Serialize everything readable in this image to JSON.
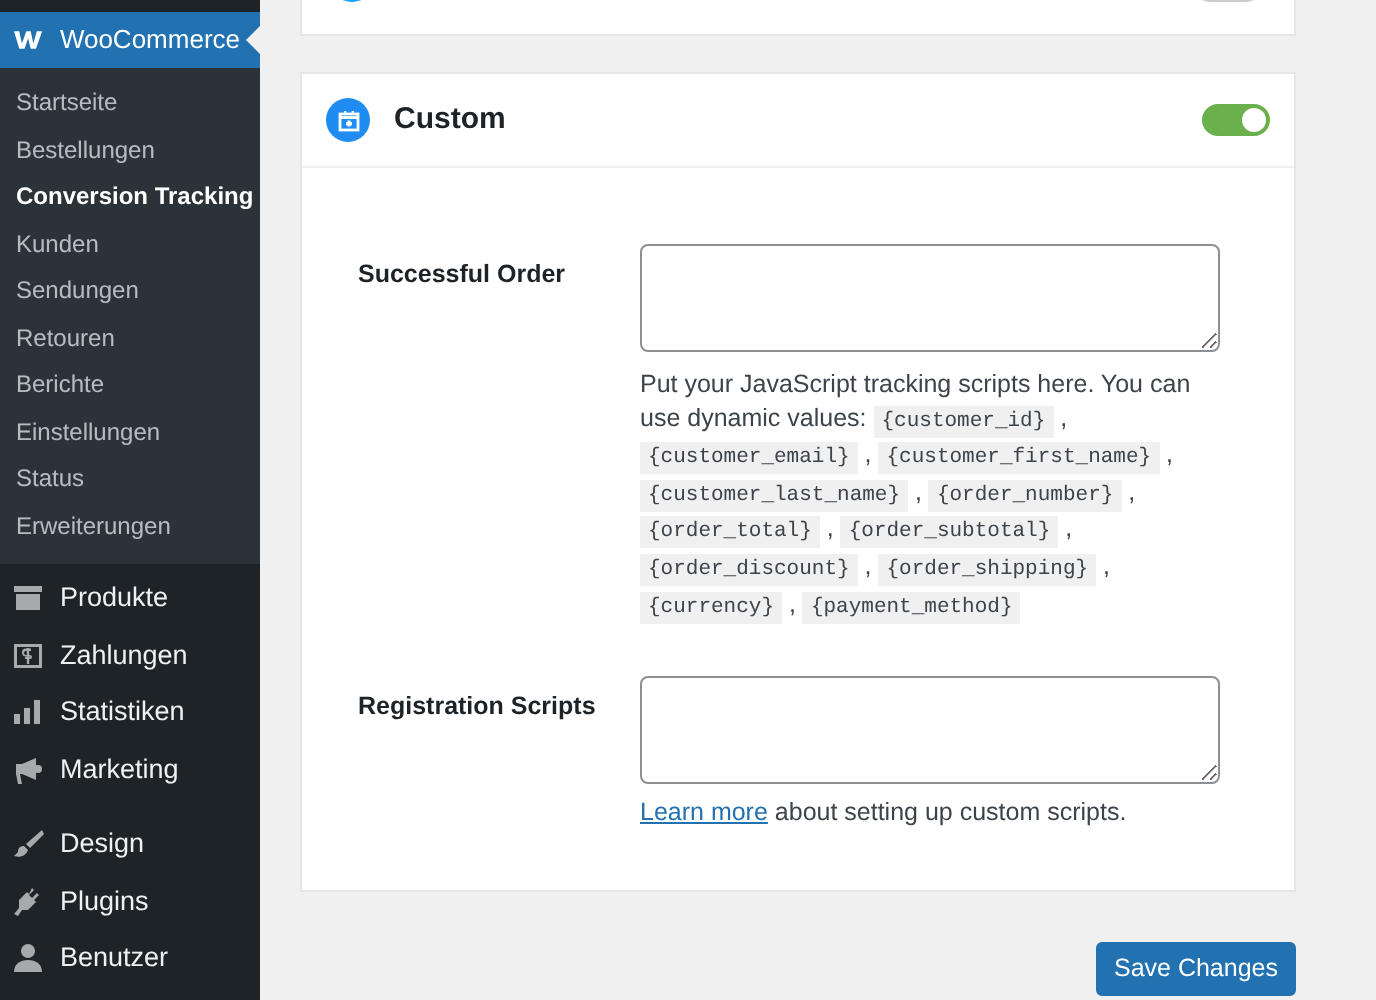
{
  "sidebar": {
    "active_menu": {
      "label": "WooCommerce",
      "selected": true,
      "submenu": [
        {
          "label": "Startseite",
          "selected": false
        },
        {
          "label": "Bestellungen",
          "selected": false
        },
        {
          "label": "Conversion Tracking",
          "selected": true
        },
        {
          "label": "Kunden",
          "selected": false
        },
        {
          "label": "Sendungen",
          "selected": false
        },
        {
          "label": "Retouren",
          "selected": false
        },
        {
          "label": "Berichte",
          "selected": false
        },
        {
          "label": "Einstellungen",
          "selected": false
        },
        {
          "label": "Status",
          "selected": false
        },
        {
          "label": "Erweiterungen",
          "selected": false
        }
      ]
    },
    "menu_groups": [
      [
        {
          "label": "Produkte",
          "kind": "box",
          "selected": false
        },
        {
          "label": "Zahlungen",
          "kind": "dollar",
          "selected": false
        },
        {
          "label": "Statistiken",
          "kind": "bars",
          "selected": false
        },
        {
          "label": "Marketing",
          "kind": "megaphone",
          "selected": false
        }
      ],
      [
        {
          "label": "Design",
          "kind": "brush",
          "selected": false
        },
        {
          "label": "Plugins",
          "kind": "plug",
          "selected": false
        },
        {
          "label": "Benutzer",
          "kind": "person",
          "selected": false
        }
      ]
    ]
  },
  "previous_card": {
    "enabled": false
  },
  "custom": {
    "title": "Custom",
    "enabled": true,
    "fields": [
      {
        "label": "Successful Order",
        "description": {
          "text": "Put your JavaScript tracking scripts here. You can use dynamic values:",
          "separator": ",",
          "values": [
            "{customer_id}",
            "{customer_email}",
            "{customer_first_name}",
            "{customer_last_name}",
            "{order_number}",
            "{order_total}",
            "{order_subtotal}",
            "{order_discount}",
            "{order_shipping}",
            "{currency}",
            "{payment_method}"
          ]
        }
      },
      {
        "label": "Registration Scripts",
        "help": {
          "link": "Learn more",
          "text": "about setting up custom scripts."
        }
      }
    ]
  },
  "save_button": "Save Changes"
}
